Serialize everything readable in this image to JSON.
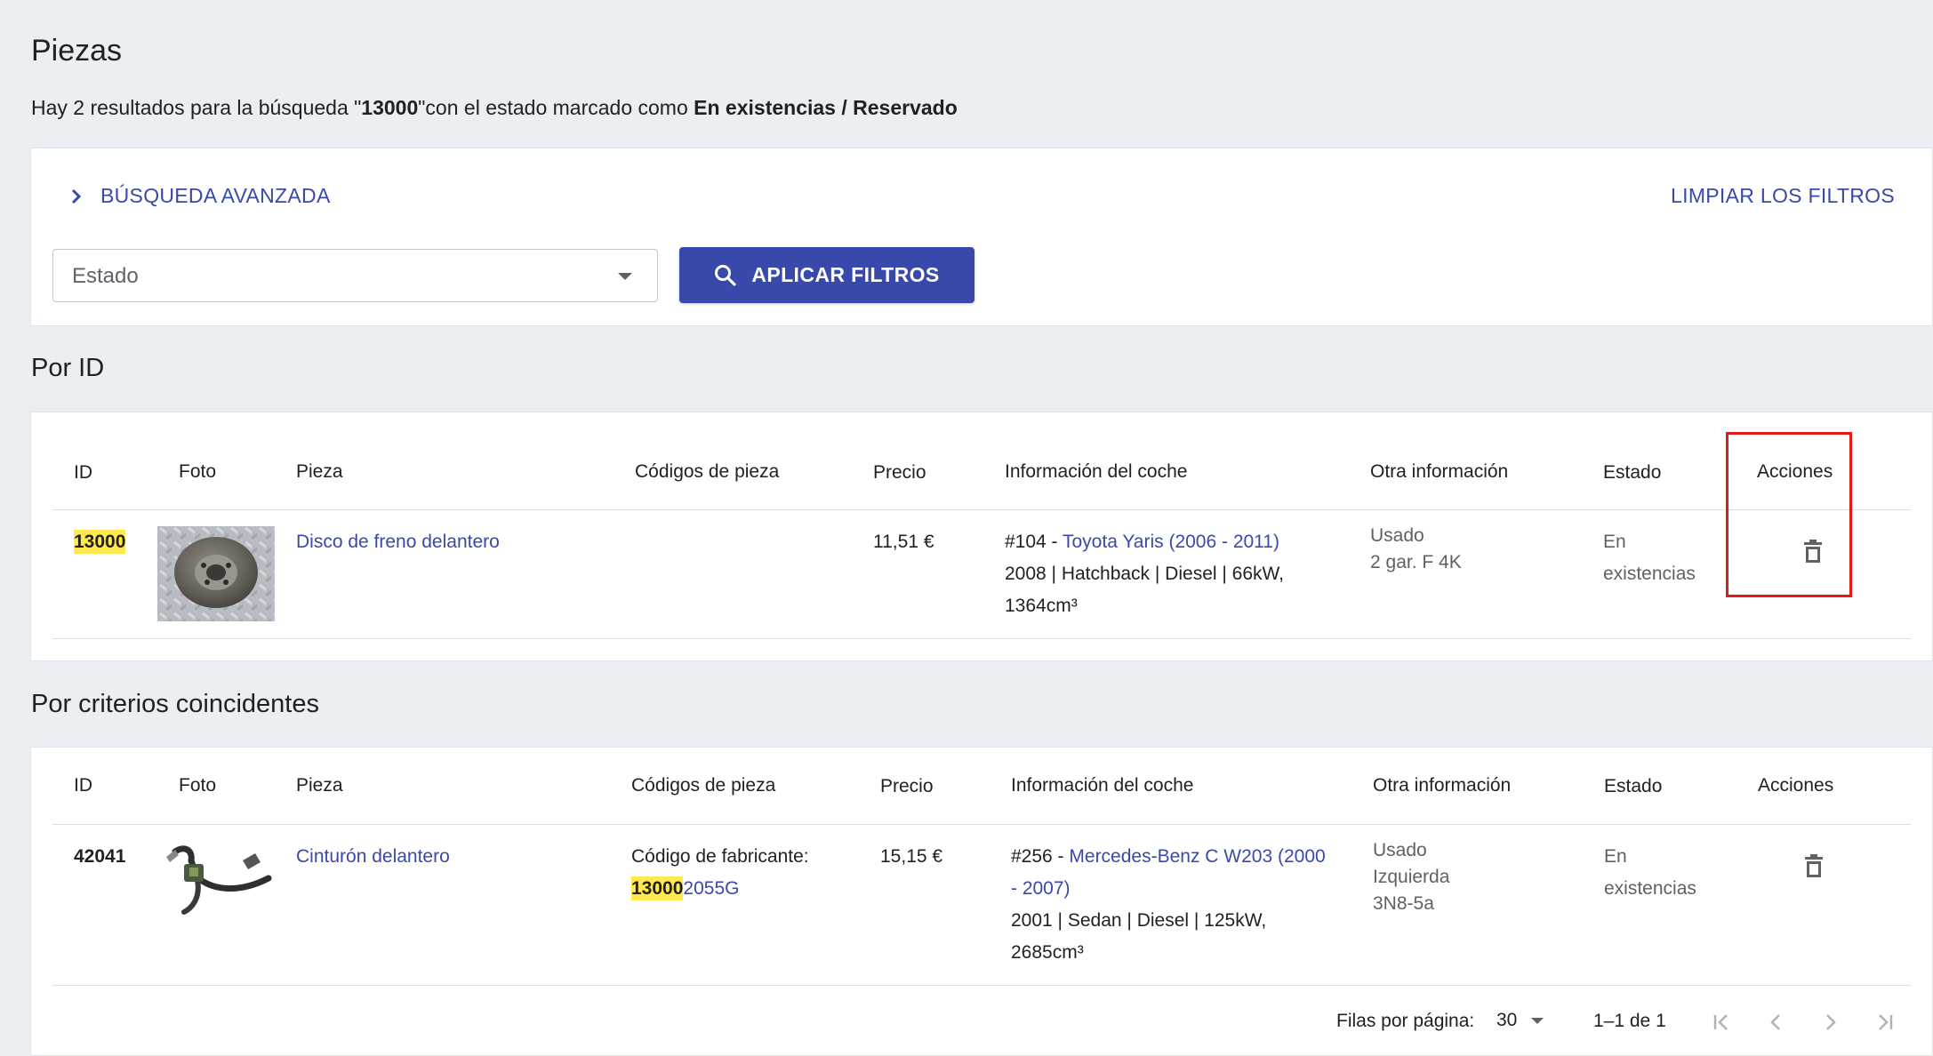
{
  "page": {
    "title": "Piezas",
    "summary_prefix": "Hay 2 resultados para la búsqueda \"",
    "summary_query": "13000",
    "summary_mid": "\"con el estado marcado como ",
    "summary_state": "En existencias / Reservado"
  },
  "filters": {
    "advanced_label": "BÚSQUEDA AVANZADA",
    "clear_label": "LIMPIAR LOS FILTROS",
    "state_placeholder": "Estado",
    "apply_label": "APLICAR FILTROS"
  },
  "columns": {
    "id": "ID",
    "photo": "Foto",
    "part": "Pieza",
    "codes": "Códigos de pieza",
    "price": "Precio",
    "car_info": "Información del coche",
    "other_info": "Otra información",
    "state": "Estado",
    "actions": "Acciones"
  },
  "by_id": {
    "title": "Por ID",
    "row": {
      "id": "13000",
      "part": "Disco de freno delantero",
      "codes": "",
      "price": "11,51 €",
      "car_ref": "#104 - ",
      "car_link": "Toyota Yaris (2006 - 2011)",
      "car_details_1": "2008 | Hatchback | Diesel | 66kW,",
      "car_details_2": "1364cm³",
      "other_1": "Usado",
      "other_2": "2 gar. F 4K",
      "state_1": "En",
      "state_2": "existencias"
    }
  },
  "by_criteria": {
    "title": "Por criterios coincidentes",
    "row": {
      "id": "42041",
      "part": "Cinturón delantero",
      "codes_label": "Código de fabricante:",
      "code_highlight": "13000",
      "code_rest": "2055G",
      "price": "15,15 €",
      "car_ref": "#256 - ",
      "car_link_1": "Mercedes-Benz C W203 (2000",
      "car_link_2": "- 2007)",
      "car_details_1": "2001 | Sedan | Diesel | 125kW,",
      "car_details_2": "2685cm³",
      "other_1": "Usado",
      "other_2": "Izquierda",
      "other_3": "3N8-5a",
      "state_1": "En",
      "state_2": "existencias"
    }
  },
  "pagination": {
    "rows_per_page_label": "Filas por página:",
    "rows_per_page_value": "30",
    "range": "1–1 de 1"
  },
  "colors": {
    "accent": "#3949ab",
    "highlight": "#ffe94d",
    "annotation_box": "#e01a1a"
  }
}
